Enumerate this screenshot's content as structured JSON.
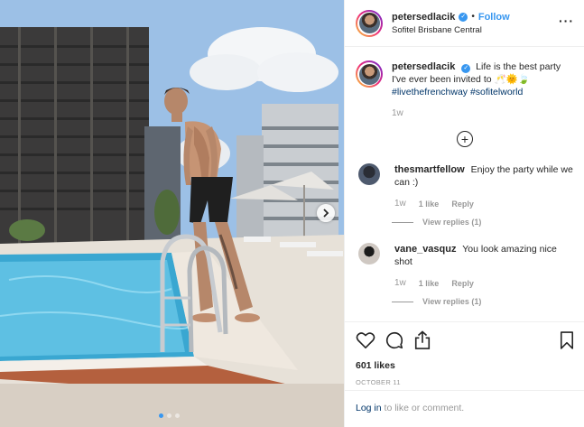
{
  "header": {
    "username": "petersedlacik",
    "separator": "•",
    "follow_label": "Follow",
    "location": "Sofitel Brisbane Central",
    "more_icon": "more-horizontal-icon"
  },
  "caption": {
    "username": "petersedlacik",
    "text": "Life is the best party I've ever been invited to 🥂🌞🍃",
    "hashtags": "#livethefrenchway #sofitelworld",
    "time": "1w"
  },
  "load_more_icon": "plus-circle-icon",
  "comments": [
    {
      "username": "thesmartfellow",
      "text": "Enjoy the party while we can :)",
      "time": "1w",
      "likes": "1 like",
      "reply": "Reply",
      "view_replies": "View replies (1)"
    },
    {
      "username": "vane_vasquz",
      "text": "You look amazing nice shot",
      "time": "1w",
      "likes": "1 like",
      "reply": "Reply",
      "view_replies": "View replies (1)"
    }
  ],
  "actions": {
    "likes_count": "601 likes",
    "date": "OCTOBER 11"
  },
  "login_prompt": {
    "link": "Log in",
    "text": " to like or comment."
  },
  "carousel": {
    "slide_count": 3,
    "active_index": 0
  },
  "colors": {
    "accent": "#3897f0",
    "hashtag": "#003569",
    "muted": "#999999"
  }
}
